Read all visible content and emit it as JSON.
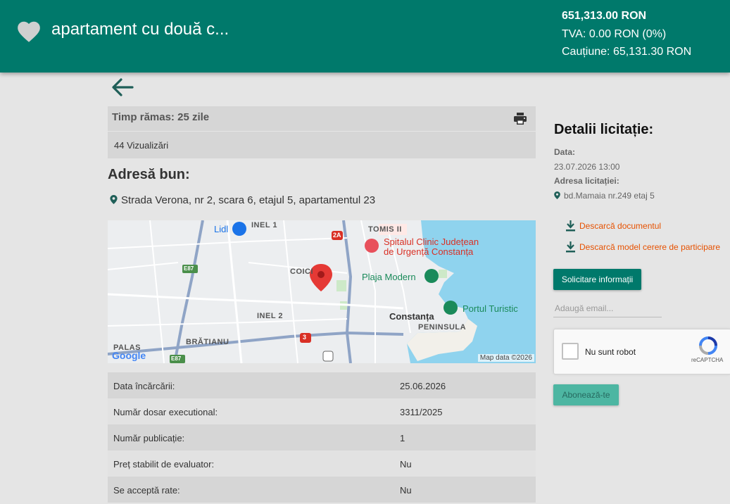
{
  "header": {
    "title": "apartament cu două c...",
    "price": "651,313.00 RON",
    "tva": "TVA: 0.00 RON (0%)",
    "cautiune": "Cauțiune: 65,131.30 RON",
    "accent": "#00796b"
  },
  "status": {
    "time_label": "Timp rămas:",
    "time_value": "25 zile",
    "views": "44 Vizualizări"
  },
  "address": {
    "heading": "Adresă bun:",
    "text": "Strada Verona, nr 2, scara 6, etajul 5, apartamentul 23"
  },
  "map": {
    "labels": {
      "inel1": "INEL 1",
      "tomis": "TOMIS II",
      "coici": "COICI",
      "inel2": "INEL 2",
      "bratianu": "BRĂTIANU",
      "palas": "PALAS",
      "peninsula": "PENINSULA",
      "constanta": "Constanța",
      "lidl": "Lidl",
      "hospital_1": "Spitalul Clinic Județean",
      "hospital_2": "de Urgență Constanța",
      "beach": "Plaja Modern",
      "port": "Portul Turistic",
      "e87a": "E87",
      "e87b": "E87",
      "r2a": "2A",
      "r3": "3",
      "google": "Google",
      "attribution": "Map data ©2026"
    }
  },
  "details": [
    {
      "key": "Data încărcării:",
      "value": "25.06.2026"
    },
    {
      "key": "Număr dosar executional:",
      "value": "3311/2025"
    },
    {
      "key": "Număr publicație:",
      "value": "1"
    },
    {
      "key": "Preț stabilit de evaluator:",
      "value": "Nu"
    },
    {
      "key": "Se acceptă rate:",
      "value": "Nu"
    }
  ],
  "sidebar": {
    "heading": "Detalii licitație:",
    "date_label": "Data:",
    "date_value": "23.07.2026 13:00",
    "address_label": "Adresa licitației:",
    "address_value": "bd.Mamaia nr.249 etaj 5",
    "download_doc": "Descarcă documentul",
    "download_model": "Descarcă model cerere de participare",
    "info_button": "Solicitare informații",
    "email_placeholder": "Adaugă email...",
    "captcha_text": "Nu sunt robot",
    "captcha_brand": "reCAPTCHA",
    "subscribe_button": "Abonează-te"
  }
}
